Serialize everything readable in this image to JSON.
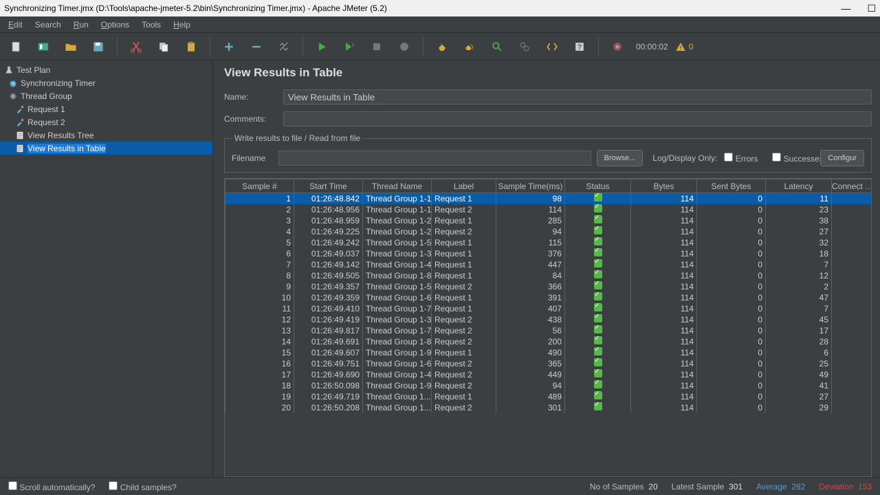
{
  "window": {
    "title": "Synchronizing Timer.jmx (D:\\Tools\\apache-jmeter-5.2\\bin\\Synchronizing Timer.jmx) - Apache JMeter (5.2)"
  },
  "menu": {
    "edit": "Edit",
    "search": "Search",
    "run": "Run",
    "options": "Options",
    "tools": "Tools",
    "help": "Help"
  },
  "toolbar": {
    "timer": "00:00:02",
    "warn_count": "0"
  },
  "tree": {
    "items": [
      {
        "label": "Test Plan",
        "lvl": 1
      },
      {
        "label": "Synchronizing Timer",
        "lvl": 2
      },
      {
        "label": "Thread Group",
        "lvl": 2
      },
      {
        "label": "Request 1",
        "lvl": 3
      },
      {
        "label": "Request 2",
        "lvl": 3
      },
      {
        "label": "View Results Tree",
        "lvl": 3
      },
      {
        "label": "View Results in Table",
        "lvl": 3,
        "selected": true
      }
    ]
  },
  "panel": {
    "heading": "View Results in Table",
    "name_label": "Name:",
    "name_value": "View Results in Table",
    "comments_label": "Comments:",
    "comments_value": "",
    "writeread_legend": "Write results to file / Read from file",
    "filename_label": "Filename",
    "filename_value": "",
    "browse": "Browse...",
    "logdisplay": "Log/Display Only:",
    "errors": "Errors",
    "successes": "Successes",
    "configure": "Configur"
  },
  "table": {
    "headers": [
      "Sample #",
      "Start Time",
      "Thread Name",
      "Label",
      "Sample Time(ms)",
      "Status",
      "Bytes",
      "Sent Bytes",
      "Latency",
      "Connect Tim"
    ],
    "rows": [
      {
        "n": "1",
        "t": "01:26:48.842",
        "th": "Thread Group 1-1",
        "lb": "Request 1",
        "st": "98",
        "by": "114",
        "sb": "0",
        "la": "11",
        "ct": "",
        "sel": true
      },
      {
        "n": "2",
        "t": "01:26:48.956",
        "th": "Thread Group 1-1",
        "lb": "Request 2",
        "st": "114",
        "by": "114",
        "sb": "0",
        "la": "23",
        "ct": ""
      },
      {
        "n": "3",
        "t": "01:26:48.959",
        "th": "Thread Group 1-2",
        "lb": "Request 1",
        "st": "285",
        "by": "114",
        "sb": "0",
        "la": "38",
        "ct": ""
      },
      {
        "n": "4",
        "t": "01:26:49.225",
        "th": "Thread Group 1-2",
        "lb": "Request 2",
        "st": "94",
        "by": "114",
        "sb": "0",
        "la": "27",
        "ct": ""
      },
      {
        "n": "5",
        "t": "01:26:49.242",
        "th": "Thread Group 1-5",
        "lb": "Request 1",
        "st": "115",
        "by": "114",
        "sb": "0",
        "la": "32",
        "ct": ""
      },
      {
        "n": "6",
        "t": "01:26:49.037",
        "th": "Thread Group 1-3",
        "lb": "Request 1",
        "st": "376",
        "by": "114",
        "sb": "0",
        "la": "18",
        "ct": ""
      },
      {
        "n": "7",
        "t": "01:26:49.142",
        "th": "Thread Group 1-4",
        "lb": "Request 1",
        "st": "447",
        "by": "114",
        "sb": "0",
        "la": "7",
        "ct": ""
      },
      {
        "n": "8",
        "t": "01:26:49.505",
        "th": "Thread Group 1-8",
        "lb": "Request 1",
        "st": "84",
        "by": "114",
        "sb": "0",
        "la": "12",
        "ct": ""
      },
      {
        "n": "9",
        "t": "01:26:49.357",
        "th": "Thread Group 1-5",
        "lb": "Request 2",
        "st": "366",
        "by": "114",
        "sb": "0",
        "la": "2",
        "ct": ""
      },
      {
        "n": "10",
        "t": "01:26:49.359",
        "th": "Thread Group 1-6",
        "lb": "Request 1",
        "st": "391",
        "by": "114",
        "sb": "0",
        "la": "47",
        "ct": ""
      },
      {
        "n": "11",
        "t": "01:26:49.410",
        "th": "Thread Group 1-7",
        "lb": "Request 1",
        "st": "407",
        "by": "114",
        "sb": "0",
        "la": "7",
        "ct": ""
      },
      {
        "n": "12",
        "t": "01:26:49.419",
        "th": "Thread Group 1-3",
        "lb": "Request 2",
        "st": "438",
        "by": "114",
        "sb": "0",
        "la": "45",
        "ct": ""
      },
      {
        "n": "13",
        "t": "01:26:49.817",
        "th": "Thread Group 1-7",
        "lb": "Request 2",
        "st": "56",
        "by": "114",
        "sb": "0",
        "la": "17",
        "ct": ""
      },
      {
        "n": "14",
        "t": "01:26:49.691",
        "th": "Thread Group 1-8",
        "lb": "Request 2",
        "st": "200",
        "by": "114",
        "sb": "0",
        "la": "28",
        "ct": ""
      },
      {
        "n": "15",
        "t": "01:26:49.607",
        "th": "Thread Group 1-9",
        "lb": "Request 1",
        "st": "490",
        "by": "114",
        "sb": "0",
        "la": "6",
        "ct": ""
      },
      {
        "n": "16",
        "t": "01:26:49.751",
        "th": "Thread Group 1-6",
        "lb": "Request 2",
        "st": "365",
        "by": "114",
        "sb": "0",
        "la": "25",
        "ct": ""
      },
      {
        "n": "17",
        "t": "01:26:49.690",
        "th": "Thread Group 1-4",
        "lb": "Request 2",
        "st": "449",
        "by": "114",
        "sb": "0",
        "la": "49",
        "ct": ""
      },
      {
        "n": "18",
        "t": "01:26:50.098",
        "th": "Thread Group 1-9",
        "lb": "Request 2",
        "st": "94",
        "by": "114",
        "sb": "0",
        "la": "41",
        "ct": ""
      },
      {
        "n": "19",
        "t": "01:26:49.719",
        "th": "Thread Group 1...",
        "lb": "Request 1",
        "st": "489",
        "by": "114",
        "sb": "0",
        "la": "27",
        "ct": ""
      },
      {
        "n": "20",
        "t": "01:26:50.208",
        "th": "Thread Group 1...",
        "lb": "Request 2",
        "st": "301",
        "by": "114",
        "sb": "0",
        "la": "29",
        "ct": ""
      }
    ]
  },
  "status": {
    "scroll": "Scroll automatically?",
    "child": "Child samples?",
    "no_samples": "No of Samples",
    "no_samples_v": "20",
    "latest": "Latest Sample",
    "latest_v": "301",
    "avg": "Average",
    "avg_v": "282",
    "dev": "Deviation",
    "dev_v": "153"
  }
}
